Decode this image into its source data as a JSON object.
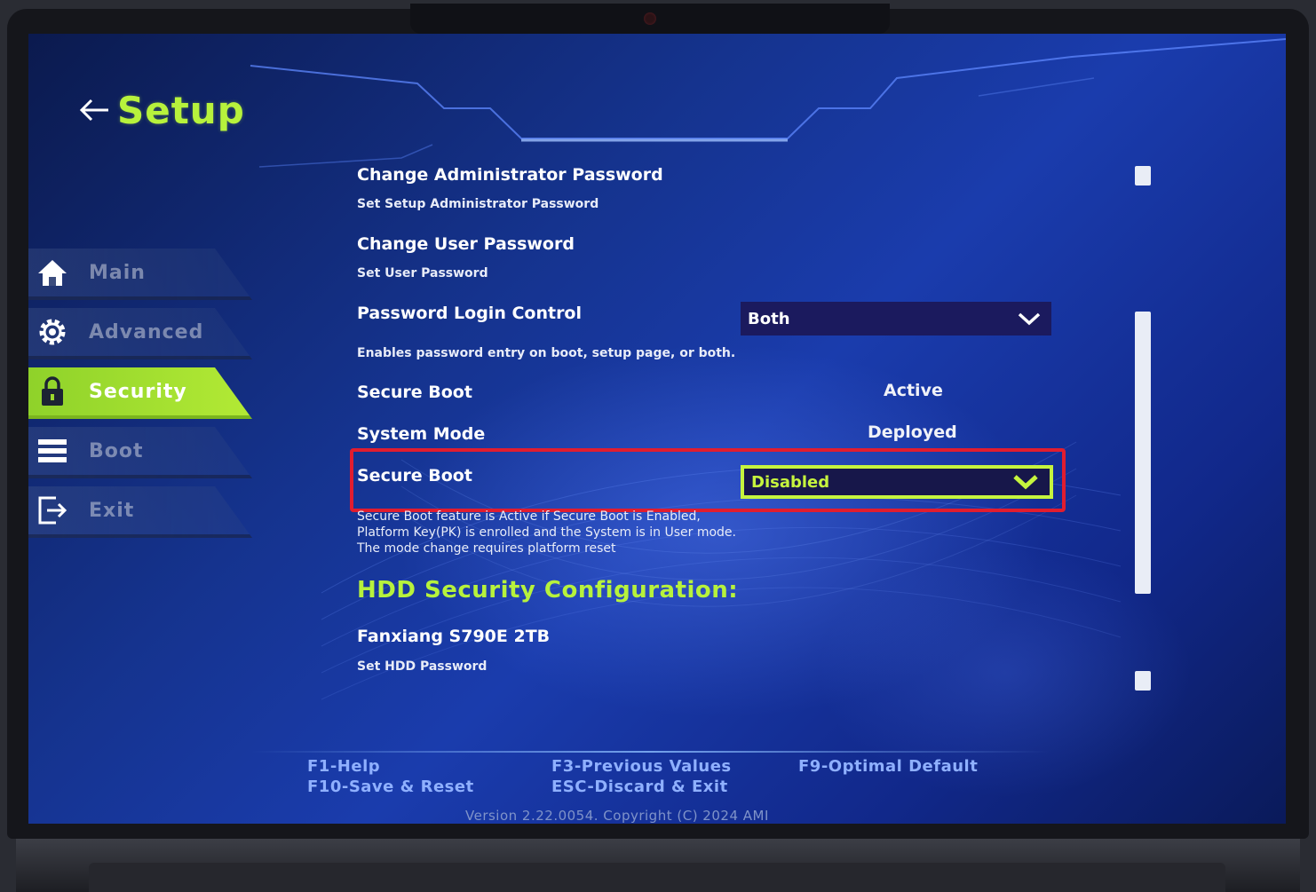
{
  "header": {
    "title": "Setup",
    "back_icon": "arrow-left-icon"
  },
  "nav": {
    "items": [
      {
        "label": "Main",
        "icon": "home-icon",
        "active": false
      },
      {
        "label": "Advanced",
        "icon": "gear-icon",
        "active": false
      },
      {
        "label": "Security",
        "icon": "lock-icon",
        "active": true
      },
      {
        "label": "Boot",
        "icon": "stack-icon",
        "active": false
      },
      {
        "label": "Exit",
        "icon": "exit-icon",
        "active": false
      }
    ]
  },
  "settings": {
    "admin_password": {
      "title": "Change Administrator Password",
      "desc": "Set Setup Administrator Password"
    },
    "user_password": {
      "title": "Change User Password",
      "desc": "Set User Password"
    },
    "password_login_control": {
      "title": "Password Login Control",
      "value": "Both",
      "desc": "Enables password entry on boot, setup page, or both."
    },
    "secure_boot_status": {
      "title": "Secure Boot",
      "value": "Active"
    },
    "system_mode": {
      "title": "System Mode",
      "value": "Deployed"
    },
    "secure_boot_setting": {
      "title": "Secure Boot",
      "value": "Disabled",
      "desc_line1": "Secure Boot feature is Active if Secure Boot is Enabled,",
      "desc_line2": "Platform Key(PK) is enrolled and the System is in User mode.",
      "desc_line3": "The mode change requires platform reset"
    },
    "hdd_section": {
      "title": "HDD Security Configuration:"
    },
    "hdd_drive": {
      "title": "Fanxiang S790E 2TB",
      "desc": "Set HDD Password"
    }
  },
  "footer": {
    "f1": "F1-Help",
    "f10": "F10-Save & Reset",
    "f3": "F3-Previous Values",
    "esc": "ESC-Discard & Exit",
    "f9": "F9-Optimal Default",
    "version": "Version 2.22.0054. Copyright (C) 2024 AMI"
  },
  "colors": {
    "accent": "#b7f23c",
    "background": "#1a3cad",
    "highlight_box": "#e11d2f"
  }
}
